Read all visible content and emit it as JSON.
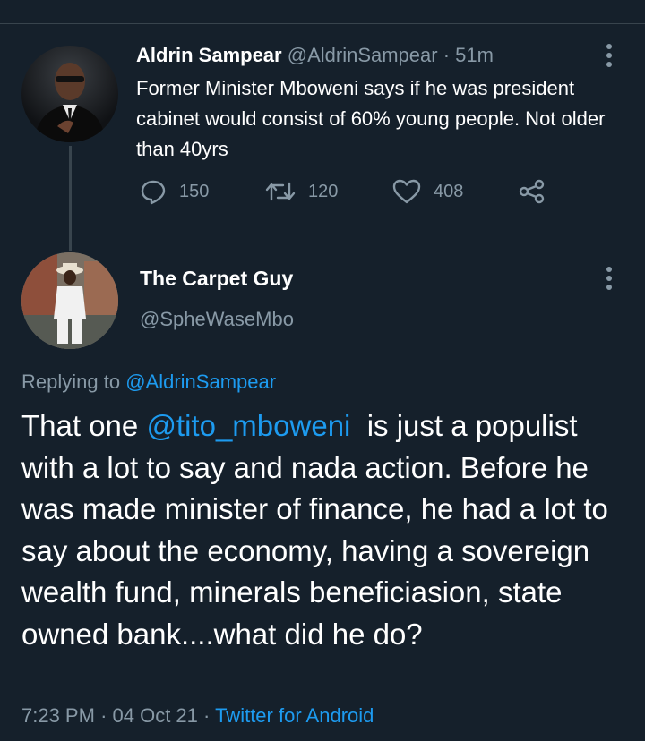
{
  "parent_tweet": {
    "author_name": "Aldrin Sampear",
    "author_handle": "@AldrinSampear",
    "separator": "·",
    "time_ago": "51m",
    "text": "Former Minister Mboweni says if he was president cabinet would consist of 60% young people. Not older than 40yrs",
    "reply_count": "150",
    "retweet_count": "120",
    "like_count": "408"
  },
  "reply_tweet": {
    "author_name": "The Carpet Guy",
    "author_handle": "@SpheWaseMbo",
    "replying_label": "Replying to",
    "replying_handle": "@AldrinSampear",
    "text_prefix": "That one ",
    "mention": "@tito_mboweni",
    "text_rest": "  is just a populist with a lot to say and nada action. Before he was made minister of finance, he had a lot to say about the economy, having a sovereign wealth fund, minerals beneficiasion, state owned bank....what did he do?",
    "time": "7:23 PM",
    "separator": "·",
    "date": "04 Oct 21",
    "source": "Twitter for Android"
  },
  "icons": {
    "reply": "reply-icon",
    "retweet": "retweet-icon",
    "like": "heart-icon",
    "share": "share-icon",
    "more": "more-options-icon"
  },
  "colors": {
    "background": "#15202b",
    "secondary_text": "#8899a6",
    "link": "#1d9bf0",
    "divider": "#38444d"
  }
}
